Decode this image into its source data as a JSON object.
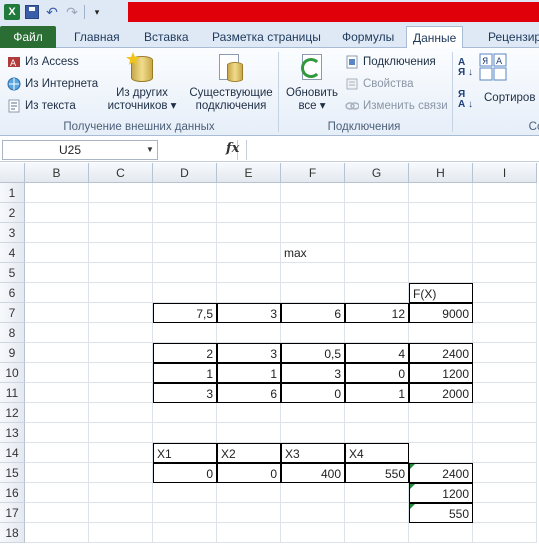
{
  "qat": {
    "undo_glyph": "↶",
    "redo_glyph": "↷"
  },
  "tabs": [
    {
      "label": "Файл"
    },
    {
      "label": "Главная"
    },
    {
      "label": "Вставка"
    },
    {
      "label": "Разметка страницы"
    },
    {
      "label": "Формулы"
    },
    {
      "label": "Данные"
    },
    {
      "label": "Рецензир"
    }
  ],
  "ribbon": {
    "get_external": {
      "access": "Из Access",
      "web": "Из Интернета",
      "text": "Из текста",
      "other_line1": "Из других",
      "other_line2": "источников",
      "existing_line1": "Существующие",
      "existing_line2": "подключения",
      "group_label": "Получение внешних данных"
    },
    "connections": {
      "refresh_line1": "Обновить",
      "refresh_line2": "все",
      "connections": "Подключения",
      "properties": "Свойства",
      "edit_links": "Изменить связи",
      "group_label": "Подключения"
    },
    "sort": {
      "sort_label": "Сортиров",
      "group_label": "Со"
    }
  },
  "formula_bar": {
    "name_box": "U25",
    "fx": "fx",
    "formula": ""
  },
  "columns": [
    "B",
    "C",
    "D",
    "E",
    "F",
    "G",
    "H",
    "I"
  ],
  "rows": [
    "1",
    "2",
    "3",
    "4",
    "5",
    "6",
    "7",
    "8",
    "9",
    "10",
    "11",
    "12",
    "13",
    "14",
    "15",
    "16",
    "17",
    "18"
  ],
  "cells": {
    "F4": "max",
    "H6": "F(X)",
    "D7": "7,5",
    "E7": "3",
    "F7": "6",
    "G7": "12",
    "H7": "9000",
    "D9": "2",
    "E9": "3",
    "F9": "0,5",
    "G9": "4",
    "H9": "2400",
    "D10": "1",
    "E10": "1",
    "F10": "3",
    "G10": "0",
    "H10": "1200",
    "D11": "3",
    "E11": "6",
    "F11": "0",
    "G11": "1",
    "H11": "2000",
    "D14": "X1",
    "E14": "X2",
    "F14": "X3",
    "G14": "X4",
    "D15": "0",
    "E15": "0",
    "F15": "400",
    "G15": "550",
    "H15": "2400",
    "H16": "1200",
    "H17": "550"
  },
  "colors": {
    "file_tab": "#2a6e34",
    "title_bar": "#e0000a",
    "error_triangle": "#1f8a3a"
  }
}
